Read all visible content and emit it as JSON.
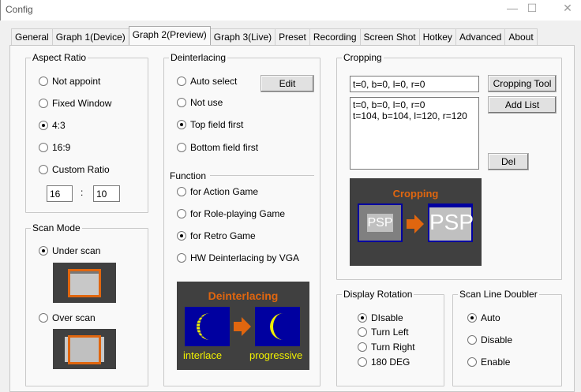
{
  "window": {
    "title": "Config",
    "minimize": "—",
    "maximize": "☐",
    "close": "✕"
  },
  "tabs": [
    "General",
    "Graph 1(Device)",
    "Graph 2(Preview)",
    "Graph 3(Live)",
    "Preset",
    "Recording",
    "Screen Shot",
    "Hotkey",
    "Advanced",
    "About"
  ],
  "active_tab": "Graph 2(Preview)",
  "aspect_ratio": {
    "label": "Aspect Ratio",
    "options": [
      "Not appoint",
      "Fixed Window",
      "4:3",
      "16:9",
      "Custom Ratio"
    ],
    "selected": "4:3",
    "custom_w": "16",
    "custom_h": "10",
    "separator": ":"
  },
  "scan_mode": {
    "label": "Scan Mode",
    "options": [
      "Under scan",
      "Over scan"
    ],
    "selected": "Under scan"
  },
  "deinterlacing": {
    "label": "Deinterlacing",
    "options": [
      "Auto select",
      "Not use",
      "Top field first",
      "Bottom field first"
    ],
    "selected": "Top field first",
    "edit_label": "Edit",
    "function_label": "Function",
    "functions": [
      "for Action Game",
      "for Role-playing Game",
      "for Retro Game",
      "HW Deinterlacing by VGA"
    ],
    "function_selected": "for Retro Game",
    "image": {
      "title": "Deinterlacing",
      "left": "interlace",
      "right": "progressive"
    }
  },
  "cropping": {
    "label": "Cropping",
    "value": "t=0, b=0, l=0, r=0",
    "list": [
      "t=0, b=0, l=0, r=0",
      "t=104, b=104, l=120, r=120"
    ],
    "tool_label": "Cropping Tool",
    "add_label": "Add List",
    "del_label": "Del",
    "image": {
      "title": "Cropping",
      "left": "PSP",
      "right": "PSP"
    }
  },
  "display_rotation": {
    "label": "Display Rotation",
    "options": [
      "DIsable",
      "Turn Left",
      "Turn Right",
      "180 DEG"
    ],
    "selected": "DIsable"
  },
  "scan_line_doubler": {
    "label": "Scan Line Doubler",
    "options": [
      "Auto",
      "Disable",
      "Enable"
    ],
    "selected": "Auto"
  },
  "colors": {
    "accent_orange": "#e0660f",
    "image_blue": "#0000a0",
    "moon_yellow": "#f0f000",
    "image_bg": "#404040"
  }
}
